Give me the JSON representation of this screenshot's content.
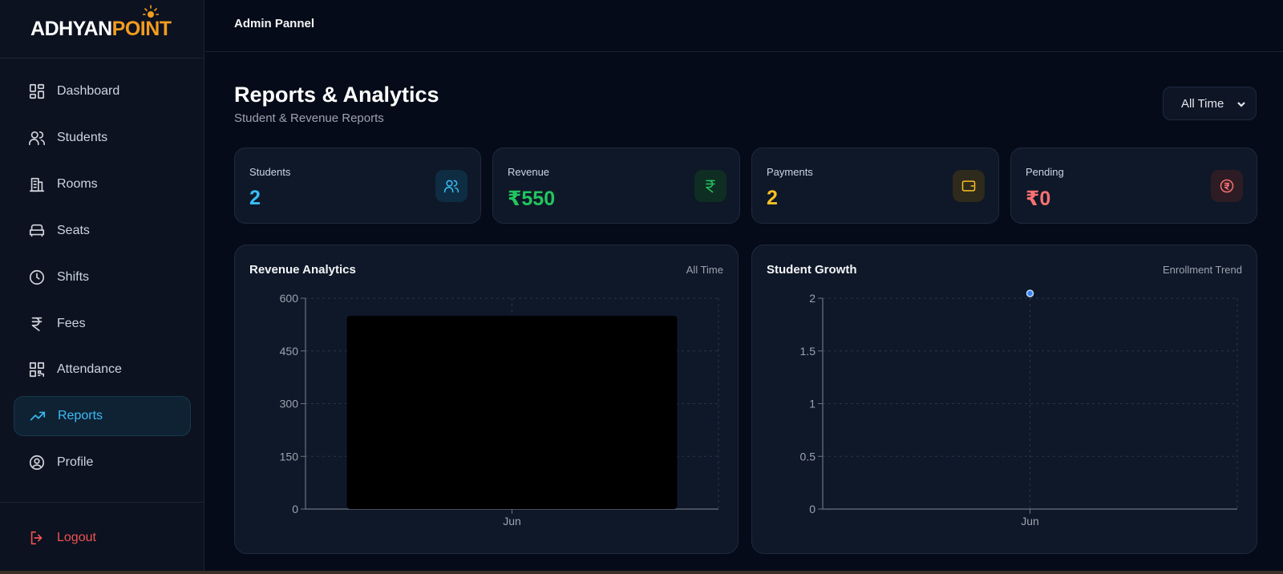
{
  "brand": {
    "part1": "DHYAN",
    "part2": "POINT",
    "a_letter": "A"
  },
  "topbar": {
    "title": "Admin Pannel"
  },
  "sidebar": {
    "items": [
      {
        "label": "Dashboard",
        "icon": "dashboard-icon"
      },
      {
        "label": "Students",
        "icon": "users-icon"
      },
      {
        "label": "Rooms",
        "icon": "building-icon"
      },
      {
        "label": "Seats",
        "icon": "sofa-icon"
      },
      {
        "label": "Shifts",
        "icon": "clock-icon"
      },
      {
        "label": "Fees",
        "icon": "rupee-icon"
      },
      {
        "label": "Attendance",
        "icon": "qr-code-icon"
      },
      {
        "label": "Reports",
        "icon": "trending-up-icon",
        "active": true
      },
      {
        "label": "Profile",
        "icon": "user-circle-icon"
      }
    ],
    "logout": "Logout"
  },
  "page": {
    "title": "Reports & Analytics",
    "subtitle": "Student & Revenue Reports",
    "range_select": "All Time"
  },
  "stats": [
    {
      "label": "Students",
      "value": "2",
      "color": "#38bdf8",
      "icon": "users-icon"
    },
    {
      "label": "Revenue",
      "value": "₹550",
      "color": "#22c55e",
      "icon": "rupee-icon"
    },
    {
      "label": "Payments",
      "value": "2",
      "color": "#fbbf24",
      "icon": "wallet-icon"
    },
    {
      "label": "Pending",
      "value": "₹0",
      "color": "#f87171",
      "icon": "rupee-coin-icon"
    }
  ],
  "panels": {
    "revenue": {
      "title": "Revenue Analytics",
      "tag": "All Time"
    },
    "growth": {
      "title": "Student Growth",
      "tag": "Enrollment Trend"
    }
  },
  "chart_data": [
    {
      "type": "bar",
      "categories": [
        "Jun"
      ],
      "values": [
        550
      ],
      "ylim": [
        0,
        600
      ],
      "yticks": [
        "0",
        "150",
        "300",
        "450",
        "600"
      ],
      "grid": true
    },
    {
      "type": "line",
      "x": [
        "Jun"
      ],
      "values": [
        2
      ],
      "ylim": [
        0,
        2
      ],
      "yticks": [
        "0",
        "0.5",
        "1",
        "1.5",
        "2"
      ],
      "grid": true
    }
  ]
}
